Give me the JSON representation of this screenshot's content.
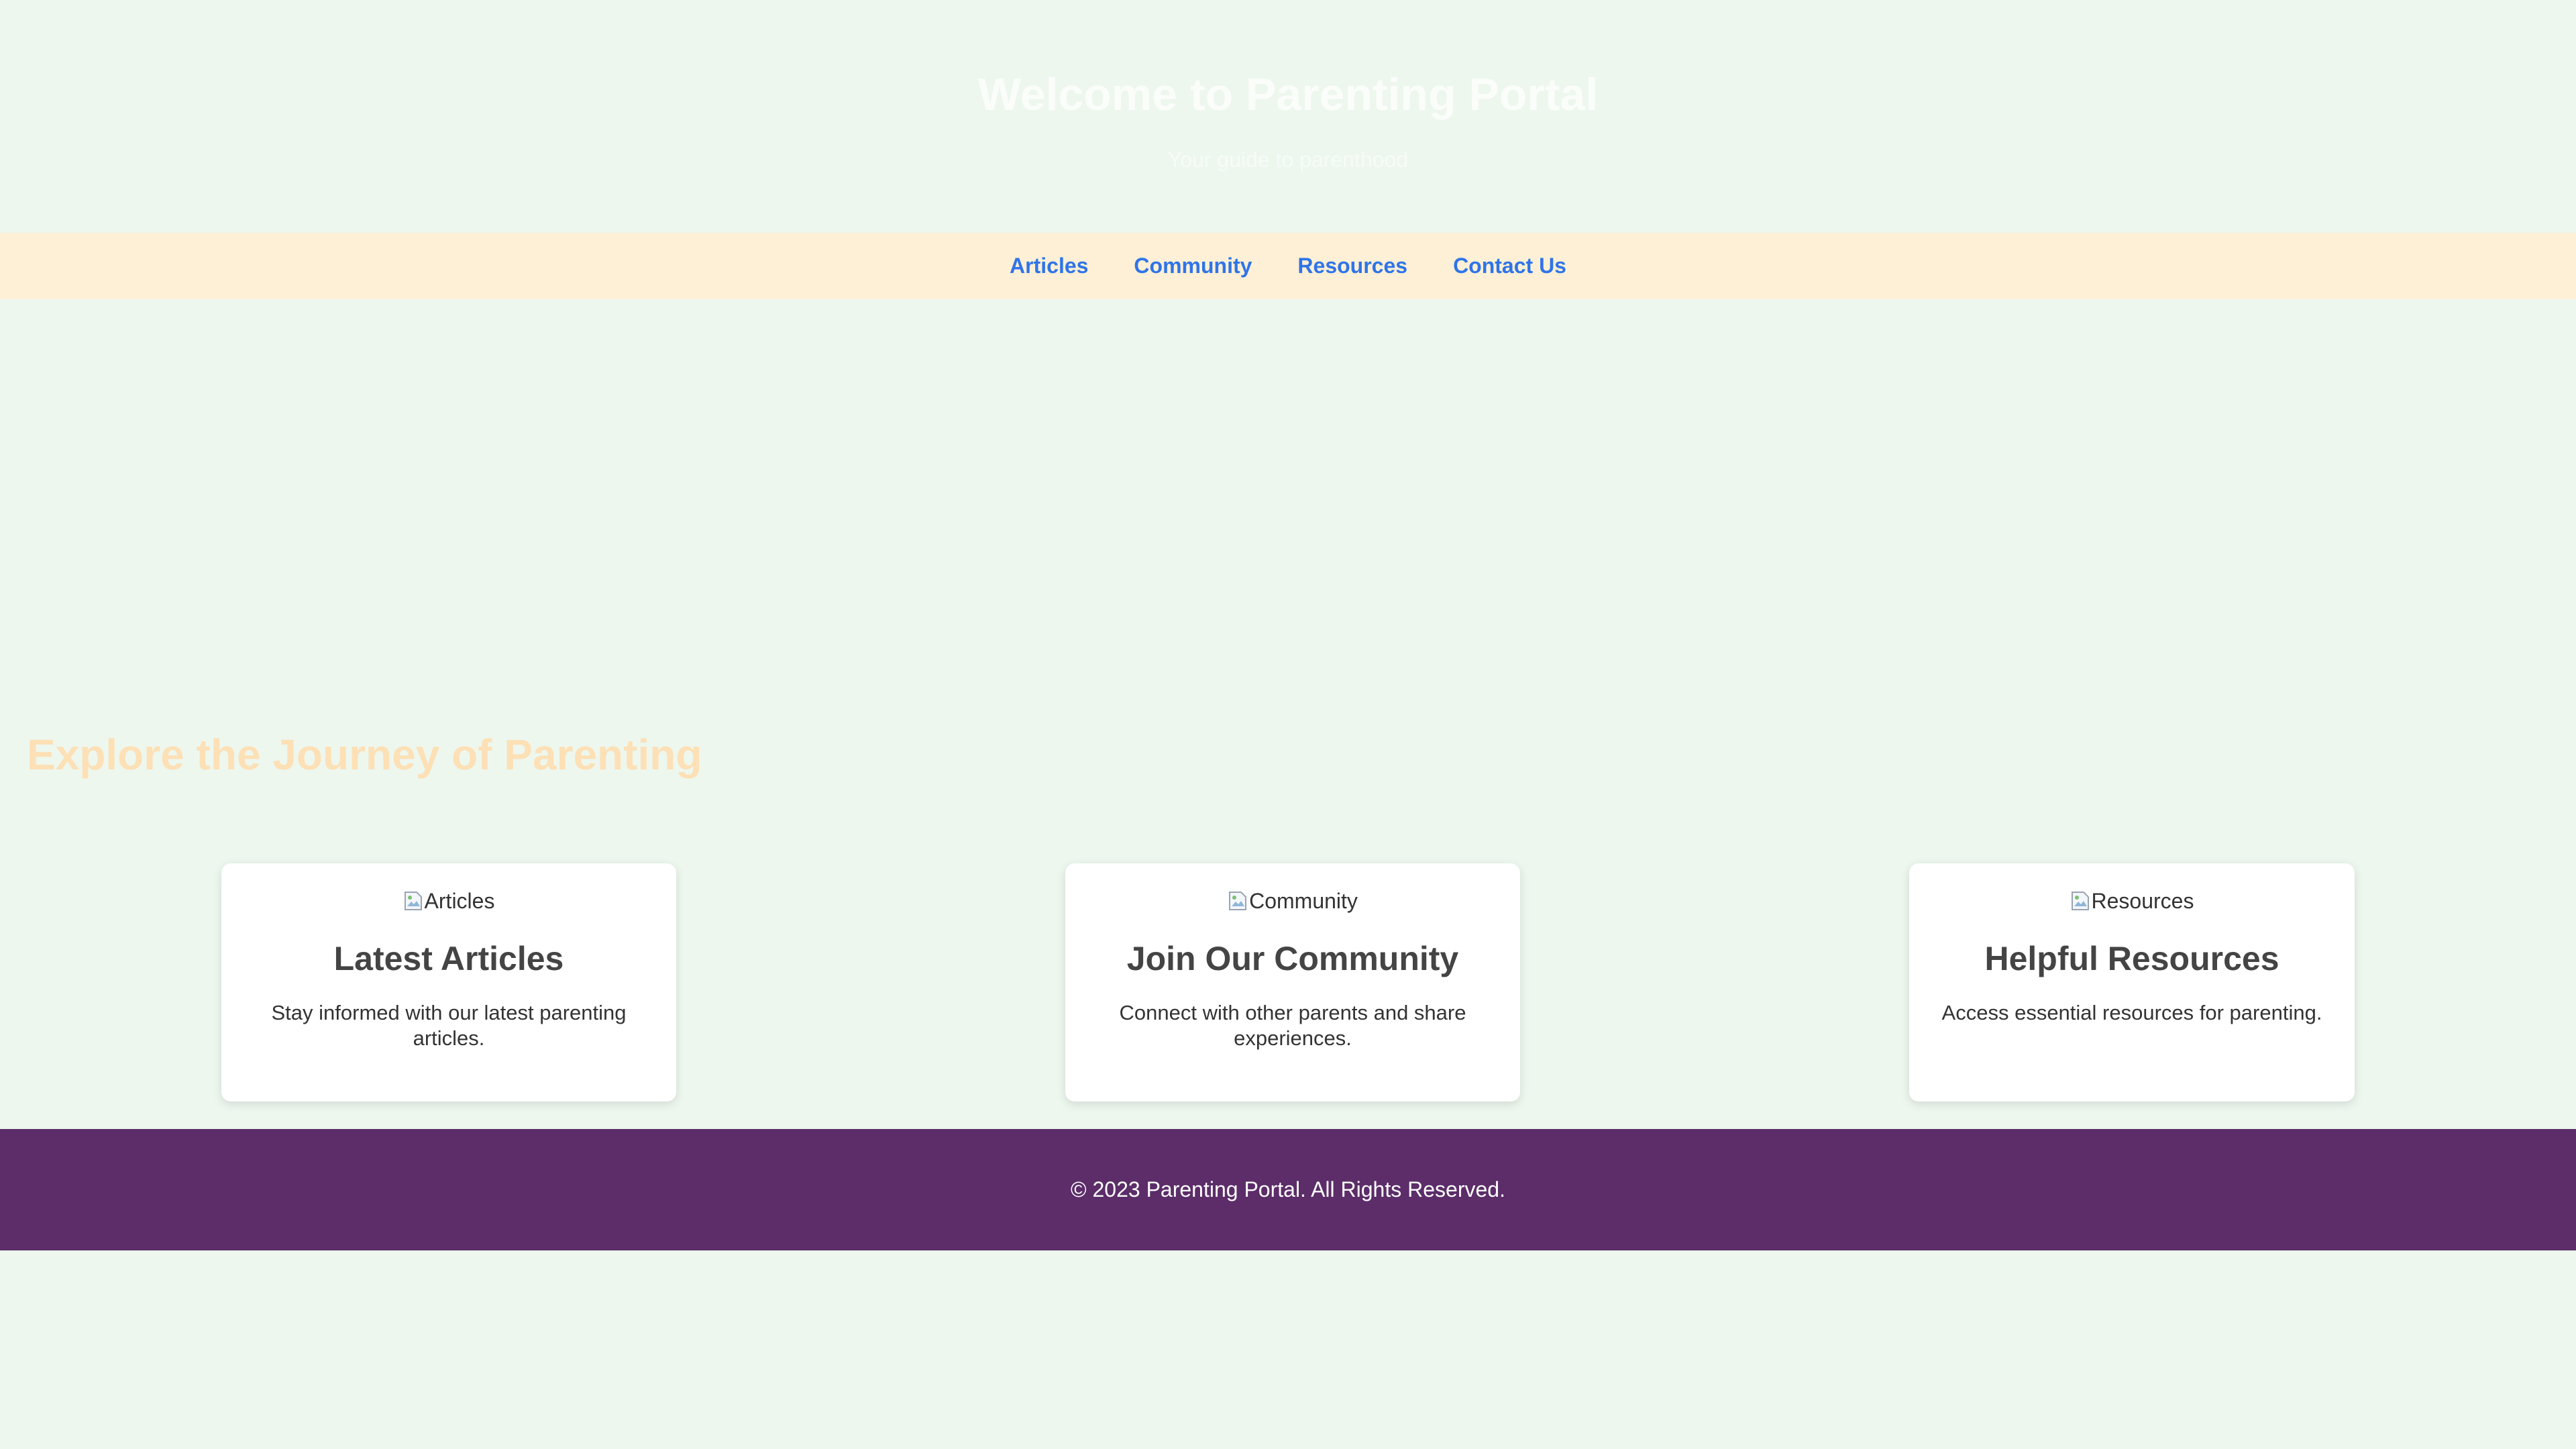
{
  "header": {
    "title": "Welcome to Parenting Portal",
    "subtitle": "Your guide to parenthood"
  },
  "nav": {
    "items": [
      {
        "label": "Articles"
      },
      {
        "label": "Community"
      },
      {
        "label": "Resources"
      },
      {
        "label": "Contact Us"
      }
    ]
  },
  "main": {
    "section_title": "Explore the Journey of Parenting",
    "cards": [
      {
        "image_alt": "Articles",
        "title": "Latest Articles",
        "description": "Stay informed with our latest parenting articles."
      },
      {
        "image_alt": "Community",
        "title": "Join Our Community",
        "description": "Connect with other parents and share experiences."
      },
      {
        "image_alt": "Resources",
        "title": "Helpful Resources",
        "description": "Access essential resources for parenting."
      }
    ]
  },
  "footer": {
    "text": "© 2023 Parenting Portal. All Rights Reserved."
  },
  "colors": {
    "background": "#edf7ee",
    "nav_background": "#fdf0d6",
    "nav_link": "#2f74e8",
    "section_title": "#fde0b6",
    "footer_background": "#5c2d69",
    "card_background": "#ffffff"
  }
}
